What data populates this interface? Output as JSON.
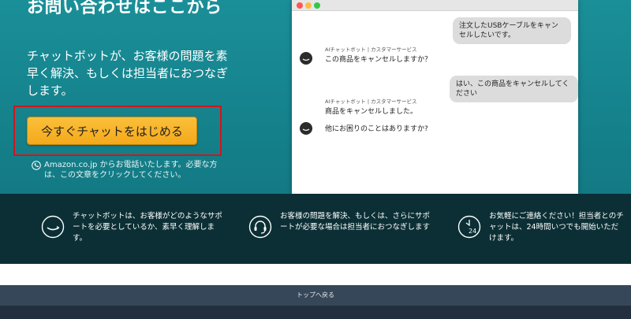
{
  "hero": {
    "title": "お問い合わせはここから",
    "description": "チャットボットが、お客様の問題を素早く解決、もしくは担当者におつなぎします。",
    "cta_label": "今すぐチャットをはじめる",
    "phone_note": "Amazon.co.jp からお電話いたします。必要な方は、この文章をクリックしてください。"
  },
  "chat": {
    "messages": [
      {
        "role": "user",
        "text": "注文したUSBケーブルをキャンセルしたいです。"
      },
      {
        "role": "bot_label",
        "text": "AIチャットボット | カスタマーサービス"
      },
      {
        "role": "bot",
        "text": "この商品をキャンセルしますか？"
      },
      {
        "role": "user",
        "text": "はい、この商品をキャンセルしてください"
      },
      {
        "role": "bot_label",
        "text": "AIチャットボット | カスタマーサービス"
      },
      {
        "role": "bot",
        "text": "商品をキャンセルしました。"
      },
      {
        "role": "bot",
        "text": "他にお困りのことはありますか?"
      }
    ]
  },
  "features": [
    {
      "icon": "smile-icon",
      "text": "チャットボットは、お客様がどのようなサポートを必要としているか、素早く理解します。"
    },
    {
      "icon": "headset-icon",
      "text": "お客様の問題を解決、もしくは、さらにサポートが必要な場合は担当者におつなぎします"
    },
    {
      "icon": "clock-24-icon",
      "text": "お気軽にご連絡ください！担当者とのチャットは、24時間いつでも開始いただけます。"
    }
  ],
  "footer": {
    "back_to_top": "トップへ戻る"
  },
  "colors": {
    "hero_bg": "#1a8f98",
    "cta": "#f4a91a",
    "highlight_frame": "#d0161c",
    "features_bg": "#0b2f35",
    "footer_bg": "#232f3e"
  }
}
